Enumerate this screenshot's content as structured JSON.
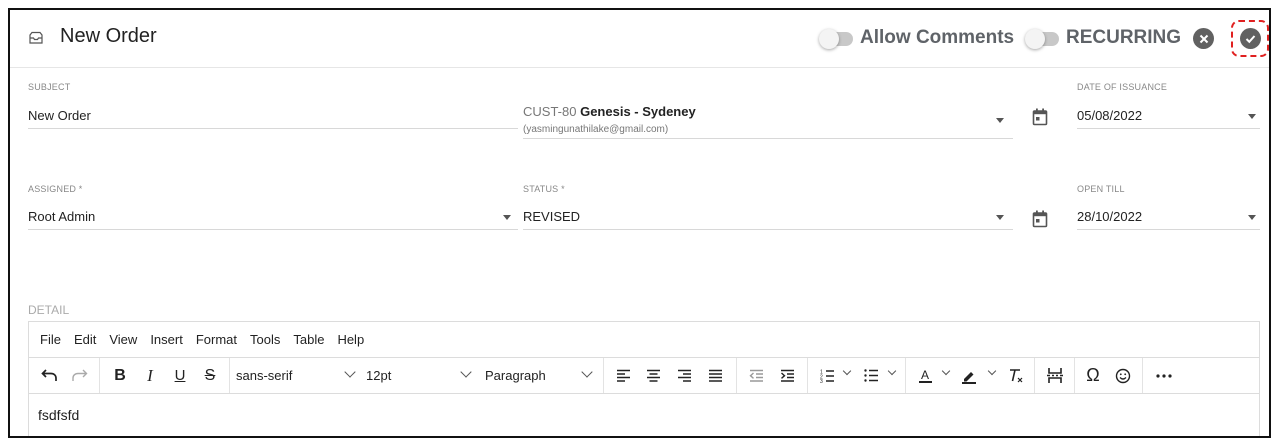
{
  "header": {
    "title": "New Order",
    "allow_comments_label": "Allow Comments",
    "recurring_label": "RECURRING"
  },
  "fields": {
    "subject": {
      "label": "SUBJECT",
      "value": "New Order"
    },
    "customer": {
      "code": "CUST-80",
      "name": "Genesis - Sydeney",
      "email": "(yasmingunathilake@gmail.com)"
    },
    "date_of_issuance": {
      "label": "DATE OF ISSUANCE",
      "value": "05/08/2022"
    },
    "assigned": {
      "label": "ASSIGNED *",
      "value": "Root Admin"
    },
    "status": {
      "label": "STATUS *",
      "value": "REVISED"
    },
    "open_till": {
      "label": "OPEN TILL",
      "value": "28/10/2022"
    }
  },
  "editor": {
    "label": "DETAIL",
    "menu": [
      "File",
      "Edit",
      "View",
      "Insert",
      "Format",
      "Tools",
      "Table",
      "Help"
    ],
    "font_family": "sans-serif",
    "font_size": "12pt",
    "block_format": "Paragraph",
    "content": "fsdfsfd"
  },
  "colors": {
    "highlight_border": "#e02020",
    "button_dark": "#616161"
  }
}
